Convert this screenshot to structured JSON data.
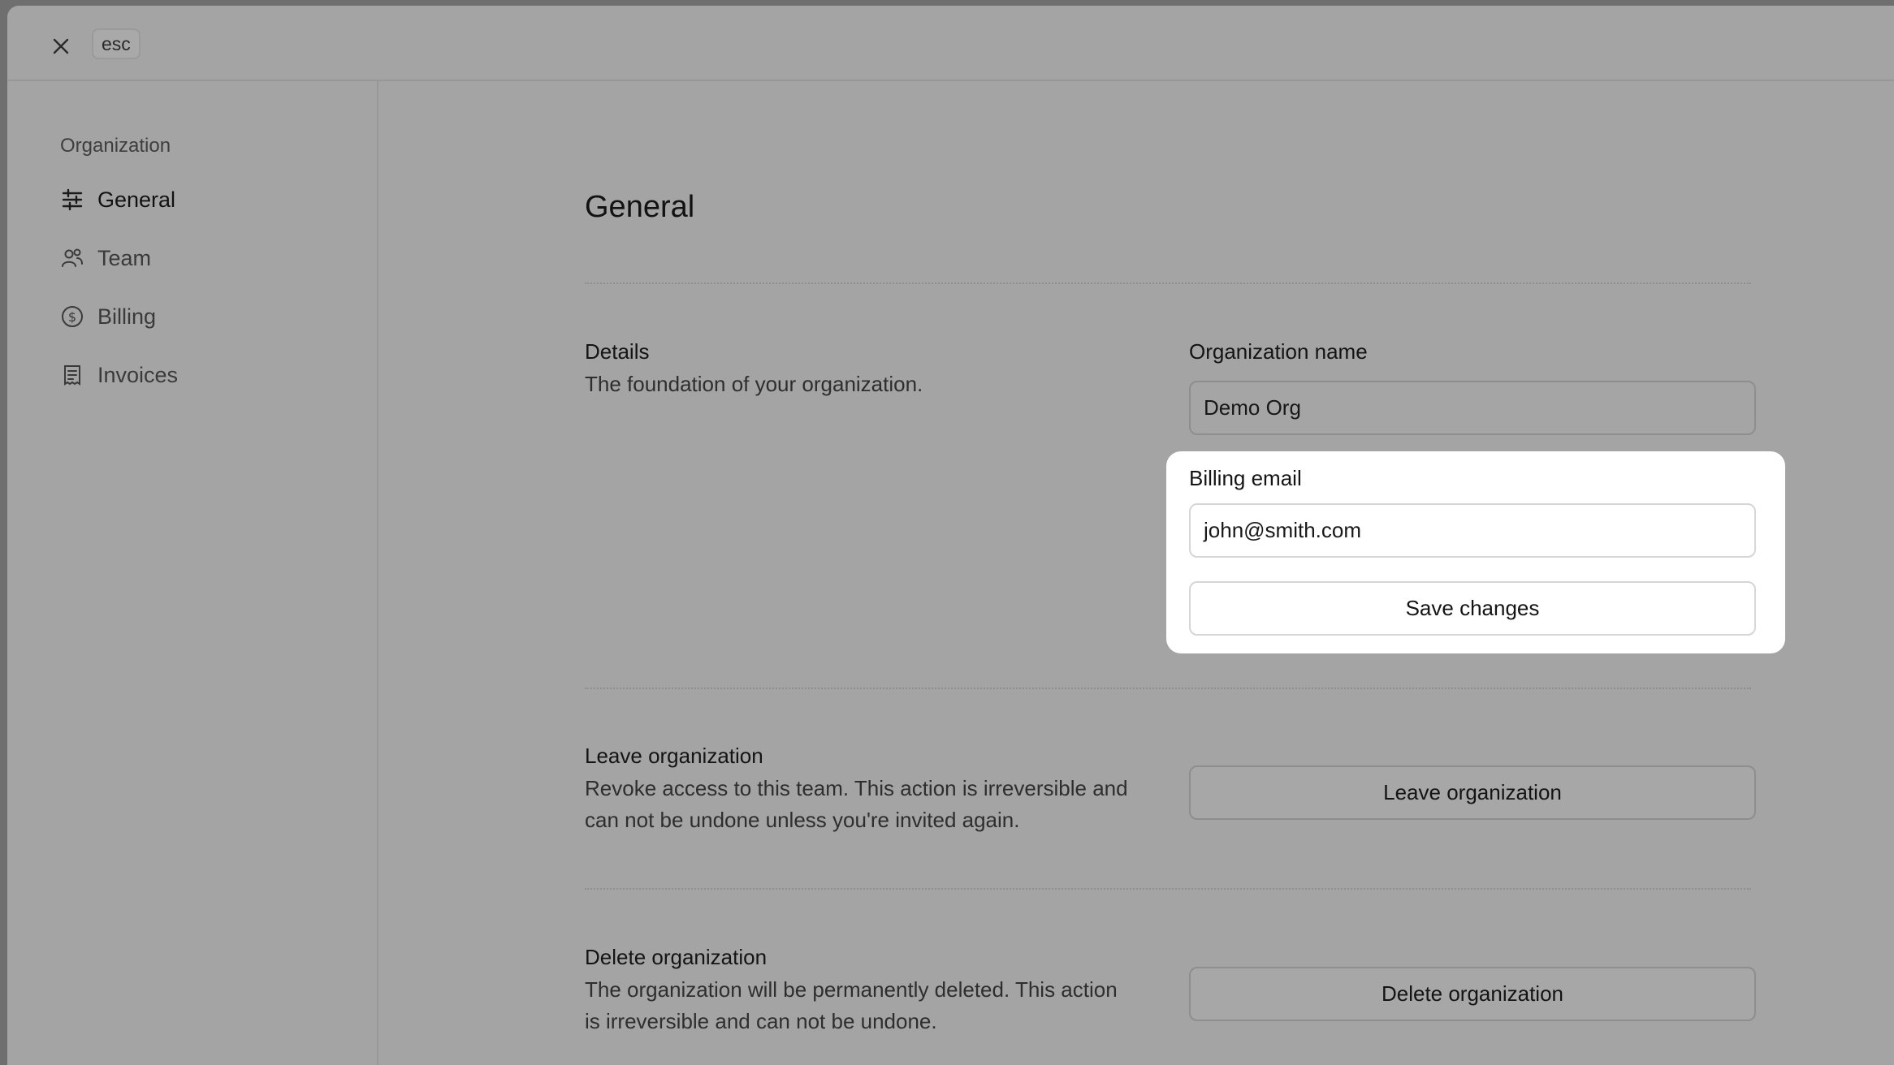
{
  "topbar": {
    "esc_label": "esc"
  },
  "sidebar": {
    "heading": "Organization",
    "items": [
      {
        "label": "General",
        "icon": "sliders-icon",
        "active": true
      },
      {
        "label": "Team",
        "icon": "users-icon",
        "active": false
      },
      {
        "label": "Billing",
        "icon": "dollar-circle-icon",
        "active": false
      },
      {
        "label": "Invoices",
        "icon": "receipt-icon",
        "active": false
      }
    ]
  },
  "main": {
    "title": "General",
    "details": {
      "title": "Details",
      "description": "The foundation of your organization.",
      "org_name_label": "Organization name",
      "org_name_value": "Demo Org",
      "billing_email_label": "Billing email",
      "billing_email_value": "john@smith.com",
      "save_label": "Save changes"
    },
    "leave": {
      "title": "Leave organization",
      "description": "Revoke access to this team. This action is irreversible and can not be undone unless you're invited again.",
      "button_label": "Leave organization"
    },
    "delete": {
      "title": "Delete organization",
      "description": "The organization will be permanently deleted. This action is irreversible and can not be undone.",
      "button_label": "Delete organization"
    }
  }
}
